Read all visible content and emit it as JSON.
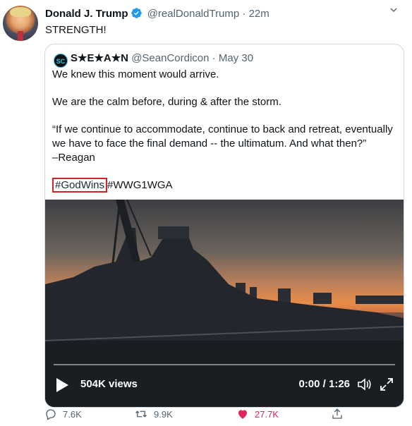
{
  "tweet": {
    "author_name": "Donald J. Trump",
    "handle": "@realDonaldTrump",
    "separator": "·",
    "time": "22m",
    "text": "STRENGTH!"
  },
  "quote": {
    "author_name": "S★E★A★N",
    "avatar_text": "SC",
    "handle": "@SeanCordicon",
    "separator": "·",
    "date": "May 30",
    "line1": "We knew this moment would arrive.",
    "line2": "We are the calm before, during & after the storm.",
    "line3": "“If we continue to accommodate, continue to back and retreat, eventually we have to face the final demand -- the ultimatum. And what then?”",
    "line4": "–Reagan",
    "hashtag1": "#GodWins",
    "hashtag2": "#WWG1WGA"
  },
  "video": {
    "views": "504K views",
    "time": "0:00 / 1:26",
    "progress": 0
  },
  "actions": {
    "replies": "7.6K",
    "retweets": "9.9K",
    "likes": "27.7K"
  },
  "colors": {
    "verified": "#1d9bf0",
    "like": "#e0245e",
    "highlight_box": "#d1232a",
    "muted": "#536471"
  },
  "icons": [
    "verified-badge-icon",
    "chevron-down-icon",
    "play-icon",
    "volume-icon",
    "fullscreen-icon",
    "reply-icon",
    "retweet-icon",
    "like-heart-icon",
    "share-icon"
  ]
}
